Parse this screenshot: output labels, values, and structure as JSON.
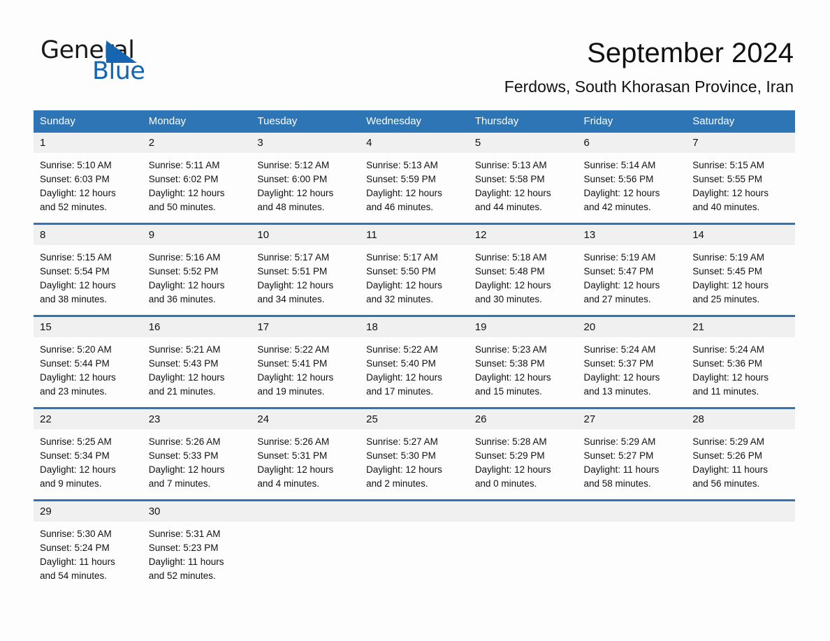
{
  "brand": {
    "name_part1": "General",
    "name_part2": "Blue",
    "triangle_color": "#1565b0"
  },
  "header": {
    "title": "September 2024",
    "subtitle": "Ferdows, South Khorasan Province, Iran"
  },
  "theme": {
    "header_blue": "#2e75b6",
    "daynum_gray": "#f0f0f0",
    "page_background": "#fdfdfd",
    "text_color": "#111111"
  },
  "weekdays": [
    "Sunday",
    "Monday",
    "Tuesday",
    "Wednesday",
    "Thursday",
    "Friday",
    "Saturday"
  ],
  "weeks": [
    [
      {
        "day": "1",
        "sunrise": "Sunrise: 5:10 AM",
        "sunset": "Sunset: 6:03 PM",
        "daylight_line1": "Daylight: 12 hours",
        "daylight_line2": "and 52 minutes."
      },
      {
        "day": "2",
        "sunrise": "Sunrise: 5:11 AM",
        "sunset": "Sunset: 6:02 PM",
        "daylight_line1": "Daylight: 12 hours",
        "daylight_line2": "and 50 minutes."
      },
      {
        "day": "3",
        "sunrise": "Sunrise: 5:12 AM",
        "sunset": "Sunset: 6:00 PM",
        "daylight_line1": "Daylight: 12 hours",
        "daylight_line2": "and 48 minutes."
      },
      {
        "day": "4",
        "sunrise": "Sunrise: 5:13 AM",
        "sunset": "Sunset: 5:59 PM",
        "daylight_line1": "Daylight: 12 hours",
        "daylight_line2": "and 46 minutes."
      },
      {
        "day": "5",
        "sunrise": "Sunrise: 5:13 AM",
        "sunset": "Sunset: 5:58 PM",
        "daylight_line1": "Daylight: 12 hours",
        "daylight_line2": "and 44 minutes."
      },
      {
        "day": "6",
        "sunrise": "Sunrise: 5:14 AM",
        "sunset": "Sunset: 5:56 PM",
        "daylight_line1": "Daylight: 12 hours",
        "daylight_line2": "and 42 minutes."
      },
      {
        "day": "7",
        "sunrise": "Sunrise: 5:15 AM",
        "sunset": "Sunset: 5:55 PM",
        "daylight_line1": "Daylight: 12 hours",
        "daylight_line2": "and 40 minutes."
      }
    ],
    [
      {
        "day": "8",
        "sunrise": "Sunrise: 5:15 AM",
        "sunset": "Sunset: 5:54 PM",
        "daylight_line1": "Daylight: 12 hours",
        "daylight_line2": "and 38 minutes."
      },
      {
        "day": "9",
        "sunrise": "Sunrise: 5:16 AM",
        "sunset": "Sunset: 5:52 PM",
        "daylight_line1": "Daylight: 12 hours",
        "daylight_line2": "and 36 minutes."
      },
      {
        "day": "10",
        "sunrise": "Sunrise: 5:17 AM",
        "sunset": "Sunset: 5:51 PM",
        "daylight_line1": "Daylight: 12 hours",
        "daylight_line2": "and 34 minutes."
      },
      {
        "day": "11",
        "sunrise": "Sunrise: 5:17 AM",
        "sunset": "Sunset: 5:50 PM",
        "daylight_line1": "Daylight: 12 hours",
        "daylight_line2": "and 32 minutes."
      },
      {
        "day": "12",
        "sunrise": "Sunrise: 5:18 AM",
        "sunset": "Sunset: 5:48 PM",
        "daylight_line1": "Daylight: 12 hours",
        "daylight_line2": "and 30 minutes."
      },
      {
        "day": "13",
        "sunrise": "Sunrise: 5:19 AM",
        "sunset": "Sunset: 5:47 PM",
        "daylight_line1": "Daylight: 12 hours",
        "daylight_line2": "and 27 minutes."
      },
      {
        "day": "14",
        "sunrise": "Sunrise: 5:19 AM",
        "sunset": "Sunset: 5:45 PM",
        "daylight_line1": "Daylight: 12 hours",
        "daylight_line2": "and 25 minutes."
      }
    ],
    [
      {
        "day": "15",
        "sunrise": "Sunrise: 5:20 AM",
        "sunset": "Sunset: 5:44 PM",
        "daylight_line1": "Daylight: 12 hours",
        "daylight_line2": "and 23 minutes."
      },
      {
        "day": "16",
        "sunrise": "Sunrise: 5:21 AM",
        "sunset": "Sunset: 5:43 PM",
        "daylight_line1": "Daylight: 12 hours",
        "daylight_line2": "and 21 minutes."
      },
      {
        "day": "17",
        "sunrise": "Sunrise: 5:22 AM",
        "sunset": "Sunset: 5:41 PM",
        "daylight_line1": "Daylight: 12 hours",
        "daylight_line2": "and 19 minutes."
      },
      {
        "day": "18",
        "sunrise": "Sunrise: 5:22 AM",
        "sunset": "Sunset: 5:40 PM",
        "daylight_line1": "Daylight: 12 hours",
        "daylight_line2": "and 17 minutes."
      },
      {
        "day": "19",
        "sunrise": "Sunrise: 5:23 AM",
        "sunset": "Sunset: 5:38 PM",
        "daylight_line1": "Daylight: 12 hours",
        "daylight_line2": "and 15 minutes."
      },
      {
        "day": "20",
        "sunrise": "Sunrise: 5:24 AM",
        "sunset": "Sunset: 5:37 PM",
        "daylight_line1": "Daylight: 12 hours",
        "daylight_line2": "and 13 minutes."
      },
      {
        "day": "21",
        "sunrise": "Sunrise: 5:24 AM",
        "sunset": "Sunset: 5:36 PM",
        "daylight_line1": "Daylight: 12 hours",
        "daylight_line2": "and 11 minutes."
      }
    ],
    [
      {
        "day": "22",
        "sunrise": "Sunrise: 5:25 AM",
        "sunset": "Sunset: 5:34 PM",
        "daylight_line1": "Daylight: 12 hours",
        "daylight_line2": "and 9 minutes."
      },
      {
        "day": "23",
        "sunrise": "Sunrise: 5:26 AM",
        "sunset": "Sunset: 5:33 PM",
        "daylight_line1": "Daylight: 12 hours",
        "daylight_line2": "and 7 minutes."
      },
      {
        "day": "24",
        "sunrise": "Sunrise: 5:26 AM",
        "sunset": "Sunset: 5:31 PM",
        "daylight_line1": "Daylight: 12 hours",
        "daylight_line2": "and 4 minutes."
      },
      {
        "day": "25",
        "sunrise": "Sunrise: 5:27 AM",
        "sunset": "Sunset: 5:30 PM",
        "daylight_line1": "Daylight: 12 hours",
        "daylight_line2": "and 2 minutes."
      },
      {
        "day": "26",
        "sunrise": "Sunrise: 5:28 AM",
        "sunset": "Sunset: 5:29 PM",
        "daylight_line1": "Daylight: 12 hours",
        "daylight_line2": "and 0 minutes."
      },
      {
        "day": "27",
        "sunrise": "Sunrise: 5:29 AM",
        "sunset": "Sunset: 5:27 PM",
        "daylight_line1": "Daylight: 11 hours",
        "daylight_line2": "and 58 minutes."
      },
      {
        "day": "28",
        "sunrise": "Sunrise: 5:29 AM",
        "sunset": "Sunset: 5:26 PM",
        "daylight_line1": "Daylight: 11 hours",
        "daylight_line2": "and 56 minutes."
      }
    ],
    [
      {
        "day": "29",
        "sunrise": "Sunrise: 5:30 AM",
        "sunset": "Sunset: 5:24 PM",
        "daylight_line1": "Daylight: 11 hours",
        "daylight_line2": "and 54 minutes."
      },
      {
        "day": "30",
        "sunrise": "Sunrise: 5:31 AM",
        "sunset": "Sunset: 5:23 PM",
        "daylight_line1": "Daylight: 11 hours",
        "daylight_line2": "and 52 minutes."
      },
      {
        "day": "",
        "sunrise": "",
        "sunset": "",
        "daylight_line1": "",
        "daylight_line2": ""
      },
      {
        "day": "",
        "sunrise": "",
        "sunset": "",
        "daylight_line1": "",
        "daylight_line2": ""
      },
      {
        "day": "",
        "sunrise": "",
        "sunset": "",
        "daylight_line1": "",
        "daylight_line2": ""
      },
      {
        "day": "",
        "sunrise": "",
        "sunset": "",
        "daylight_line1": "",
        "daylight_line2": ""
      },
      {
        "day": "",
        "sunrise": "",
        "sunset": "",
        "daylight_line1": "",
        "daylight_line2": ""
      }
    ]
  ]
}
